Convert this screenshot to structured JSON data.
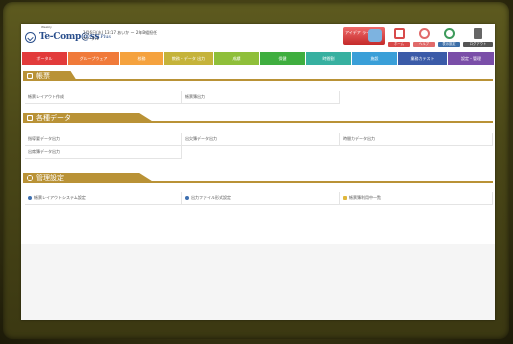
{
  "header": {
    "logo_small": "Weekly",
    "logo_text": "Te-Comp@ss",
    "logo_suffix": "Plus",
    "date_user": "1月6日(水) 13:17  あいか ー 2年B組担任",
    "page_name": "ポータル",
    "buttons": [
      {
        "label": "ホーム",
        "color": "#d84a4a",
        "icon": "home-icon"
      },
      {
        "label": "ヘルプ",
        "color": "#e06a6a",
        "icon": "help-icon"
      },
      {
        "label": "表示設定",
        "color": "#3d6fa8",
        "icon": "display-icon"
      },
      {
        "label": "ログアウト",
        "color": "#555555",
        "icon": "logout-icon"
      }
    ],
    "featured": {
      "label": "アイデア ライブラリ",
      "icon": "idea-icon"
    }
  },
  "nav": [
    {
      "label": "ポータル",
      "color": "#e23b3b"
    },
    {
      "label": "グループウェア",
      "color": "#f07a3a"
    },
    {
      "label": "校務",
      "color": "#f5a23e"
    },
    {
      "label": "教務・データ 出力",
      "color": "#c5b33a"
    },
    {
      "label": "成績",
      "color": "#8fbf3a"
    },
    {
      "label": "保健",
      "color": "#3fae3f"
    },
    {
      "label": "時間割",
      "color": "#37b0a0"
    },
    {
      "label": "施設",
      "color": "#3a9fd8"
    },
    {
      "label": "業務カテスト",
      "color": "#3b5ba8"
    },
    {
      "label": "設定・管理",
      "color": "#7a4ea8"
    }
  ],
  "sections": [
    {
      "title": "帳票",
      "items": [
        "帳票レイアウト作成",
        "帳票簿出力"
      ]
    },
    {
      "title": "各種データ",
      "items": [
        "指導要データ出力",
        "出欠簿データ出力",
        "時間カデータ出力",
        "出席簿データ出力"
      ]
    },
    {
      "title": "管理設定",
      "items": [
        "帳票レイアウトシステム設定",
        "出力ファイル形式設定",
        "帳票簿利用中一覧"
      ]
    }
  ]
}
